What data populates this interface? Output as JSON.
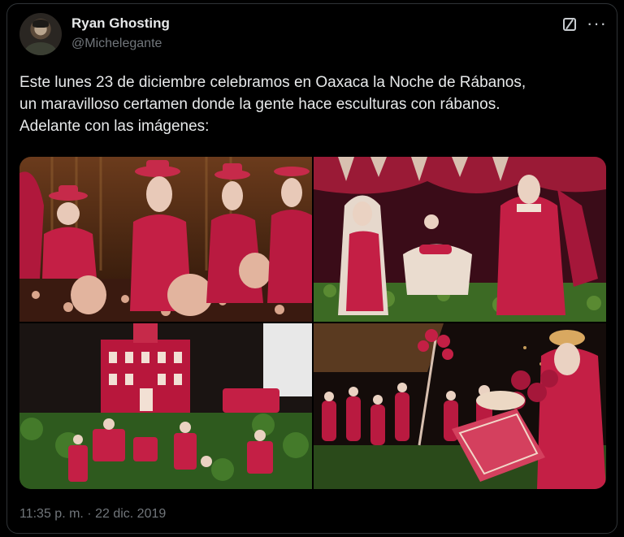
{
  "author": {
    "name": "Ryan Ghosting",
    "handle": "@Michelegante"
  },
  "tweet": {
    "lines": [
      "Este lunes 23 de diciembre celebramos en Oaxaca la Noche de Rábanos,",
      "un maravilloso certamen donde la gente hace esculturas con rábanos.",
      "Adelante con las imágenes:"
    ],
    "timestamp": "11:35 p. m. · 22 dic. 2019"
  },
  "icons": {
    "grok": "grok-icon",
    "more": "more-icon"
  },
  "media": [
    {
      "name": "radish-photo-musicians"
    },
    {
      "name": "radish-photo-nativity"
    },
    {
      "name": "radish-photo-church"
    },
    {
      "name": "radish-photo-market"
    }
  ],
  "colors": {
    "background": "#000000",
    "text_primary": "#e7e9ea",
    "text_secondary": "#71767b",
    "border": "#2f3336",
    "radish_red": "#c0204a"
  }
}
